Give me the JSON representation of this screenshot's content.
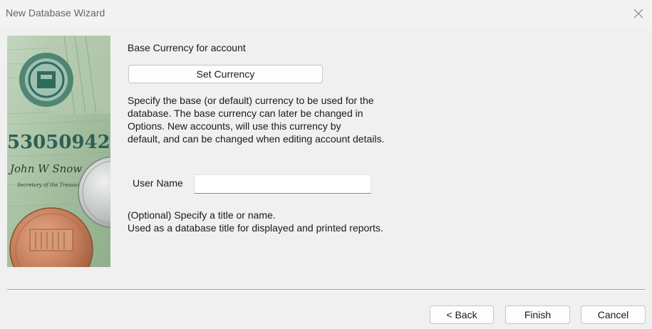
{
  "window": {
    "title": "New Database Wizard",
    "close_icon": "close-icon"
  },
  "currency": {
    "heading": "Base Currency for account",
    "button_label": "Set Currency",
    "description": "Specify the base (or default) currency to be used for the\ndatabase. The base currency can later be changed in\nOptions. New accounts, will use this currency by\ndefault, and can be changed when editing account details."
  },
  "user": {
    "label": "User Name",
    "value": "",
    "placeholder": "",
    "description": "(Optional) Specify a title or name.\nUsed as a database title for displayed and printed reports."
  },
  "footer": {
    "back_label": "< Back",
    "finish_label": "Finish",
    "cancel_label": "Cancel"
  },
  "banknote": {
    "serial": "53050942",
    "signature": "John W Snow",
    "signature_title": "Secretary of the Treasury"
  },
  "colors": {
    "window_bg": "#f0f0f0",
    "banknote_green": "#a9c3a4",
    "seal_green": "#2f6b5c",
    "penny_copper": "#c98462",
    "quarter_silver": "#c7cbc9"
  }
}
